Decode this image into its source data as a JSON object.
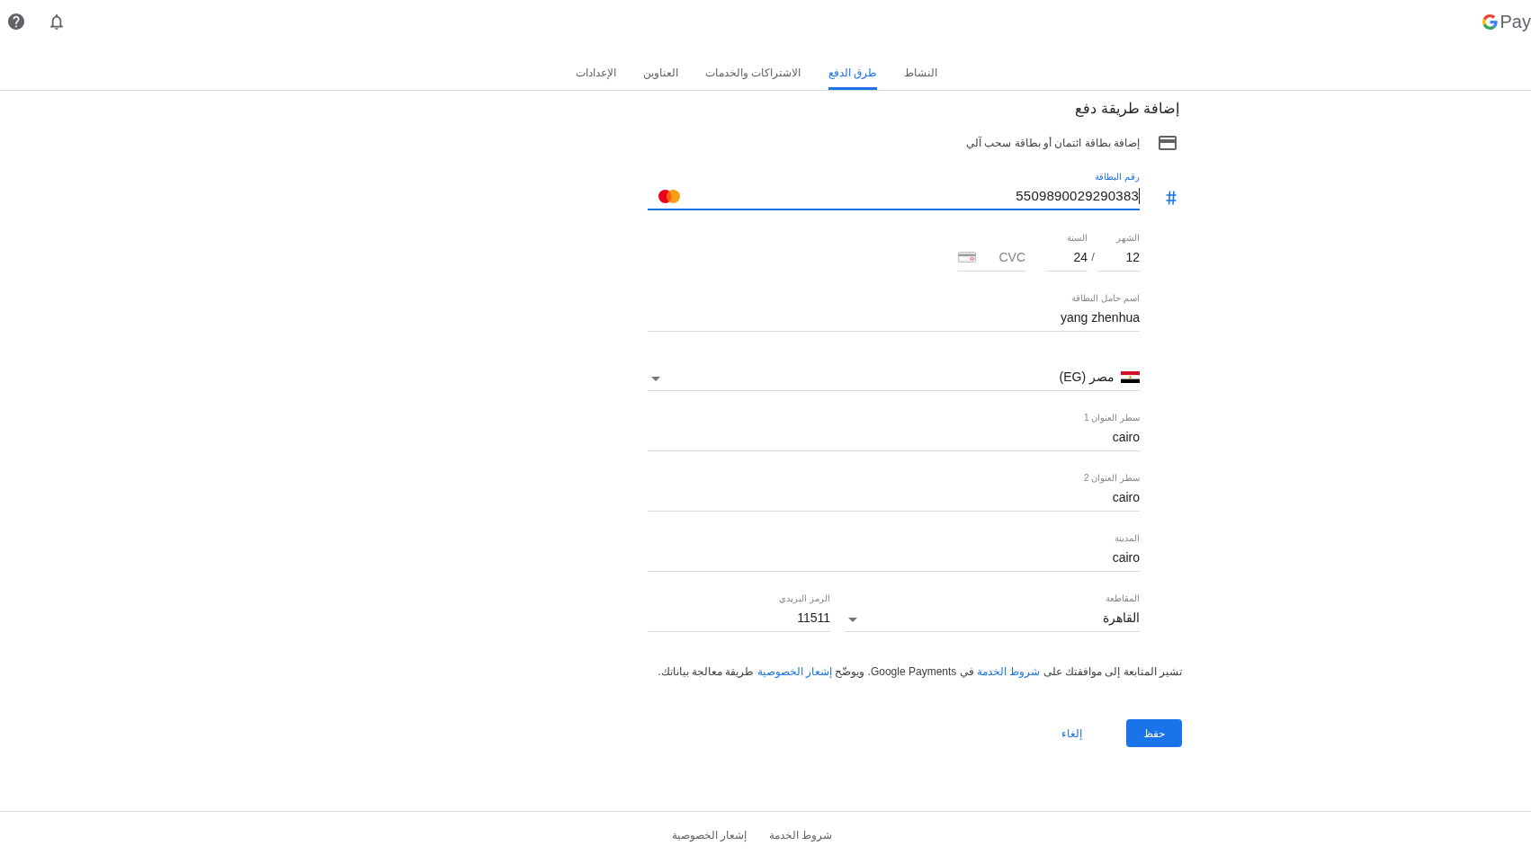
{
  "header": {
    "logo_text": "Pay"
  },
  "tabs": [
    {
      "label": "النشاط",
      "selected": false
    },
    {
      "label": "طرق الدفع",
      "selected": true
    },
    {
      "label": "الاشتراكات والخدمات",
      "selected": false
    },
    {
      "label": "العناوين",
      "selected": false
    },
    {
      "label": "الإعدادات",
      "selected": false
    }
  ],
  "form": {
    "title": "إضافة طريقة دفع",
    "card_option": "إضافة بطاقة ائتمان أو بطاقة سحب آلي",
    "card_number": {
      "label": "رقم البطاقة",
      "value": "5509890029290383",
      "focused": true
    },
    "expiry": {
      "month": {
        "label": "الشهر",
        "value": "12"
      },
      "separator": "/",
      "year": {
        "label": "السنة",
        "value": "24"
      }
    },
    "cvc": {
      "placeholder": "CVC"
    },
    "cardholder": {
      "label": "اسم حامل البطاقة",
      "value": "yang zhenhua"
    },
    "country": {
      "value": "مصر (EG)"
    },
    "address_fields": [
      {
        "label": "سطر العنوان 1",
        "value": "cairo"
      },
      {
        "label": "سطر العنوان 2",
        "value": "cairo"
      },
      {
        "label": "المدينة",
        "value": "cairo"
      }
    ],
    "governorate": {
      "label": "المقاطعة",
      "value": "القاهرة"
    },
    "postal_code": {
      "label": "الرمز البريدي",
      "value": "11511"
    }
  },
  "consent": [
    {
      "text": "تشير المتابعة إلى موافقتك على ",
      "kind": "plain"
    },
    {
      "text": "شروط الخدمة",
      "kind": "link"
    },
    {
      "text": " في Google Payments. ويوضّح ",
      "kind": "plain"
    },
    {
      "text": "إشعار الخصوصية",
      "kind": "link"
    },
    {
      "text": " طريقة معالجة بياناتك.",
      "kind": "plain"
    }
  ],
  "actions": {
    "save": "حفظ",
    "cancel": "إلغاء"
  },
  "footer": {
    "links": [
      "شروط الخدمة",
      "إشعار الخصوصية"
    ]
  }
}
